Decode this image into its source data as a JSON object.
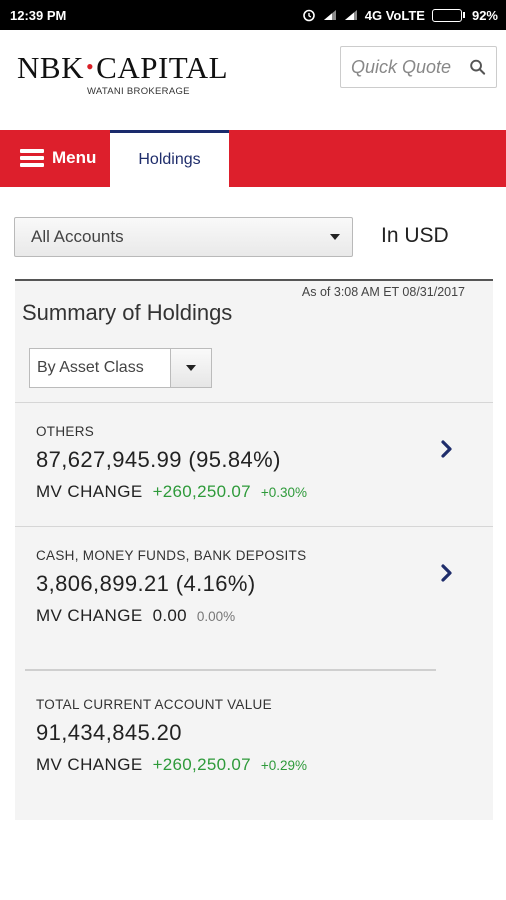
{
  "status_bar": {
    "time": "12:39 PM",
    "network": "4G VoLTE",
    "battery": "92%",
    "battery_level": 0.92
  },
  "header": {
    "logo_left": "NBK",
    "logo_dot": "•",
    "logo_right": "CAPITAL",
    "logo_sub": "WATANI BROKERAGE",
    "quick_quote_placeholder": "Quick Quote",
    "search_icon": "search-icon"
  },
  "nav": {
    "menu_label": "Menu",
    "menu_icon": "hamburger-icon",
    "active_tab": "Holdings",
    "brand_color": "#dd1f2c",
    "tab_color": "#1f2d6b"
  },
  "account": {
    "selected": "All Accounts",
    "currency": "In USD"
  },
  "summary": {
    "as_of": "As of  3:08 AM ET 08/31/2017",
    "title": "Summary of Holdings",
    "group_by": "By Asset Class",
    "mv_label": "MV CHANGE",
    "rows": [
      {
        "category": "OTHERS",
        "value": "87,627,945.99 (95.84%)",
        "mv_change": "+260,250.07",
        "mv_pct": "+0.30%"
      },
      {
        "category": "CASH, MONEY FUNDS, BANK DEPOSITS",
        "value": "3,806,899.21 (4.16%)",
        "mv_change": "0.00",
        "mv_pct": "0.00%"
      }
    ],
    "total": {
      "category": "TOTAL CURRENT ACCOUNT VALUE",
      "value": "91,434,845.20",
      "mv_change": "+260,250.07",
      "mv_pct": "+0.29%"
    },
    "positive_color": "#2e9a3a",
    "chevron_icon": "chevron-right-icon"
  }
}
